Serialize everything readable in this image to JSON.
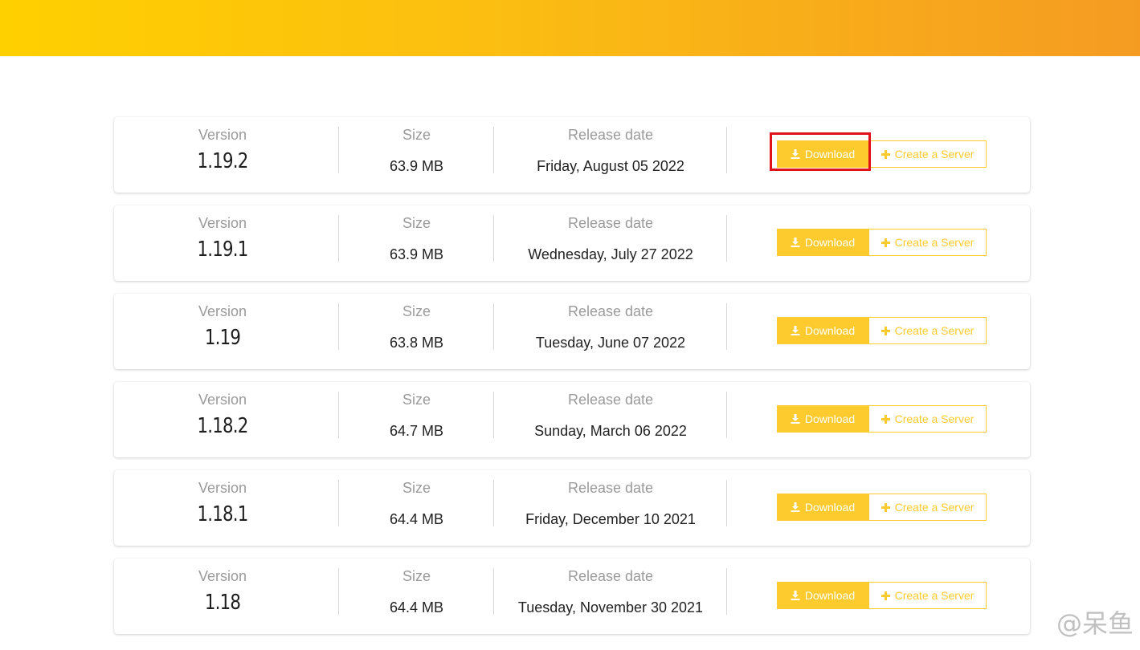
{
  "header": {
    "banner_colors": [
      "#ffd000",
      "#f59b22"
    ]
  },
  "labels": {
    "version": "Version",
    "size": "Size",
    "release_date": "Release date",
    "download": "Download",
    "create_server": "Create a Server"
  },
  "versions": [
    {
      "version": "1.19.2",
      "size": "63.9 MB",
      "release_date": "Friday, August 05 2022"
    },
    {
      "version": "1.19.1",
      "size": "63.9 MB",
      "release_date": "Wednesday, July 27 2022"
    },
    {
      "version": "1.19",
      "size": "63.8 MB",
      "release_date": "Tuesday, June 07 2022"
    },
    {
      "version": "1.18.2",
      "size": "64.7 MB",
      "release_date": "Sunday, March 06 2022"
    },
    {
      "version": "1.18.1",
      "size": "64.4 MB",
      "release_date": "Friday, December 10 2021"
    },
    {
      "version": "1.18",
      "size": "64.4 MB",
      "release_date": "Tuesday, November 30 2021"
    }
  ],
  "icons": {
    "download": "download-icon",
    "create": "plus-icon"
  },
  "colors": {
    "accent": "#fdcb2d",
    "highlight": "#e0121a"
  },
  "watermark": "@呆鱼"
}
